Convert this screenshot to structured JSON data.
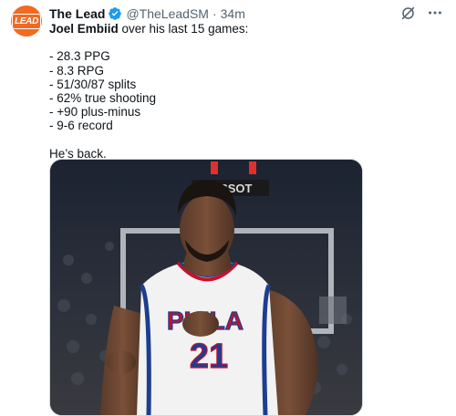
{
  "tweet": {
    "author_name": "The Lead",
    "handle": "@TheLeadSM",
    "separator": "·",
    "time": "34m",
    "avatar_logo_text": "LEAD",
    "intro_bold": "Joel Embiid",
    "intro_rest": " over his last 15 games:",
    "stats": [
      "- 28.3 PPG",
      "- 8.3 RPG",
      "- 51/30/87 splits",
      "- 62% true shooting",
      "- +90 plus-minus",
      "- 9-6 record"
    ],
    "closing": "He’s back."
  },
  "media": {
    "jersey_text": "PHILA",
    "jersey_number": "21",
    "arena_sign": "TISSOT"
  },
  "icons": [
    "verified-badge-icon",
    "grok-icon",
    "more-icon"
  ],
  "colors": {
    "verified_blue": "#1d9bf0",
    "avatar_orange": "#f26a21",
    "secondary_text": "#536471"
  }
}
